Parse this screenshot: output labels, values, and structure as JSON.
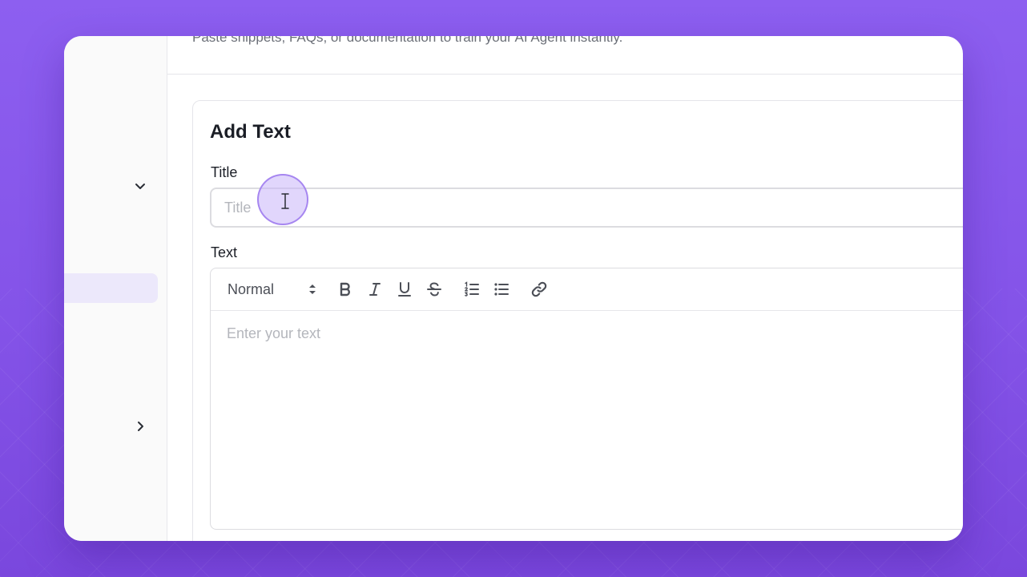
{
  "header": {
    "subtitle": "Paste snippets, FAQs, or documentation to train your AI Agent instantly."
  },
  "sidebar": {
    "icons": [
      "chevron-down-icon",
      "chevron-right-icon"
    ]
  },
  "card": {
    "heading": "Add Text",
    "title_field": {
      "label": "Title",
      "value": "",
      "placeholder": "Title"
    },
    "text_field": {
      "label": "Text",
      "placeholder": "Enter your text"
    },
    "toolbar": {
      "format_select_value": "Normal",
      "buttons": [
        "bold-icon",
        "italic-icon",
        "underline-icon",
        "strikethrough-icon",
        "ordered-list-icon",
        "bullet-list-icon",
        "link-icon"
      ]
    }
  },
  "colors": {
    "background": "#8b5cf6",
    "sidebar_active": "#ece8fb",
    "cursor_highlight": "#c8b4fa"
  }
}
